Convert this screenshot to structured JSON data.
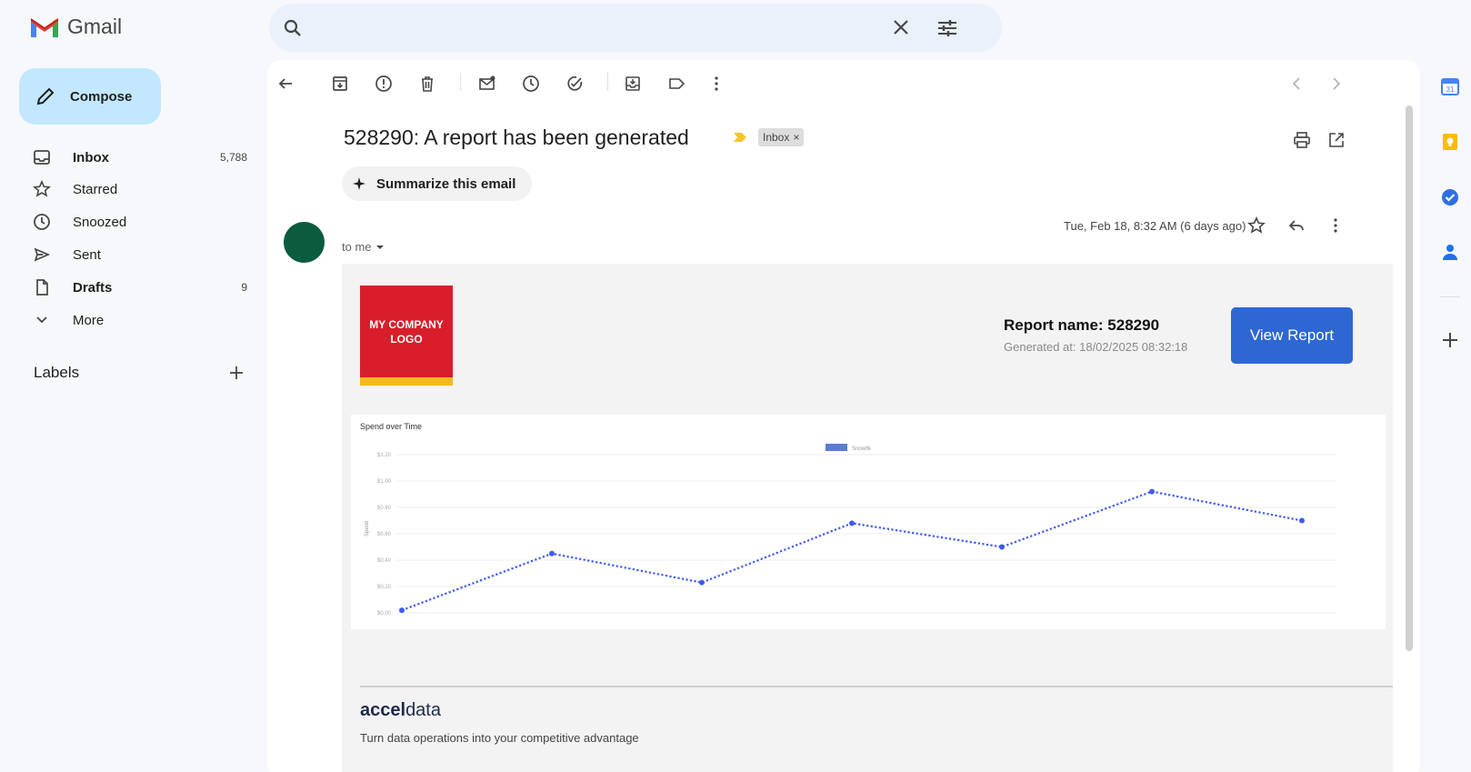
{
  "app": {
    "name": "Gmail"
  },
  "search": {
    "value": "",
    "placeholder": ""
  },
  "compose": {
    "label": "Compose"
  },
  "nav": [
    {
      "label": "Inbox",
      "count": "5,788",
      "icon": "inbox-icon"
    },
    {
      "label": "Starred",
      "count": "",
      "icon": "star-icon"
    },
    {
      "label": "Snoozed",
      "count": "",
      "icon": "clock-icon"
    },
    {
      "label": "Sent",
      "count": "",
      "icon": "send-icon"
    },
    {
      "label": "Drafts",
      "count": "9",
      "icon": "draft-icon"
    },
    {
      "label": "More",
      "count": "",
      "icon": "chevron-down-icon"
    }
  ],
  "labels": {
    "title": "Labels"
  },
  "email": {
    "subject": "528290: A report has been generated",
    "label_chip": "Inbox",
    "label_chip_close": "×",
    "summarize": "Summarize this email",
    "recipient": "to me",
    "date": "Tue, Feb 18, 8:32 AM (6 days ago)"
  },
  "report": {
    "logo_text": "MY COMPANY LOGO",
    "name": "Report name: 528290",
    "generated": "Generated at: 18/02/2025 08:32:18",
    "view_button": "View Report"
  },
  "footer": {
    "brand_bold": "accel",
    "brand_rest": "data",
    "tagline": "Turn data operations into your competitive advantage"
  },
  "chart_data": {
    "type": "line",
    "title": "Spend over Time",
    "xlabel": "",
    "ylabel": "Spend",
    "ylim": [
      0,
      1.2
    ],
    "y_ticks": [
      "$0.00",
      "$0.20",
      "$0.40",
      "$0.60",
      "$0.80",
      "$1.00",
      "$1.20"
    ],
    "grid": true,
    "legend": "top-center",
    "series": [
      {
        "name": "Snowflk",
        "color": "#3d5af1",
        "x": [
          0,
          1,
          2,
          3,
          4,
          5,
          6
        ],
        "values": [
          0.02,
          0.45,
          0.23,
          0.68,
          0.5,
          0.92,
          0.7
        ]
      }
    ]
  },
  "colors": {
    "accent": "#2e67d3",
    "compose_bg": "#c2e7ff",
    "series": "#3d5af1"
  }
}
